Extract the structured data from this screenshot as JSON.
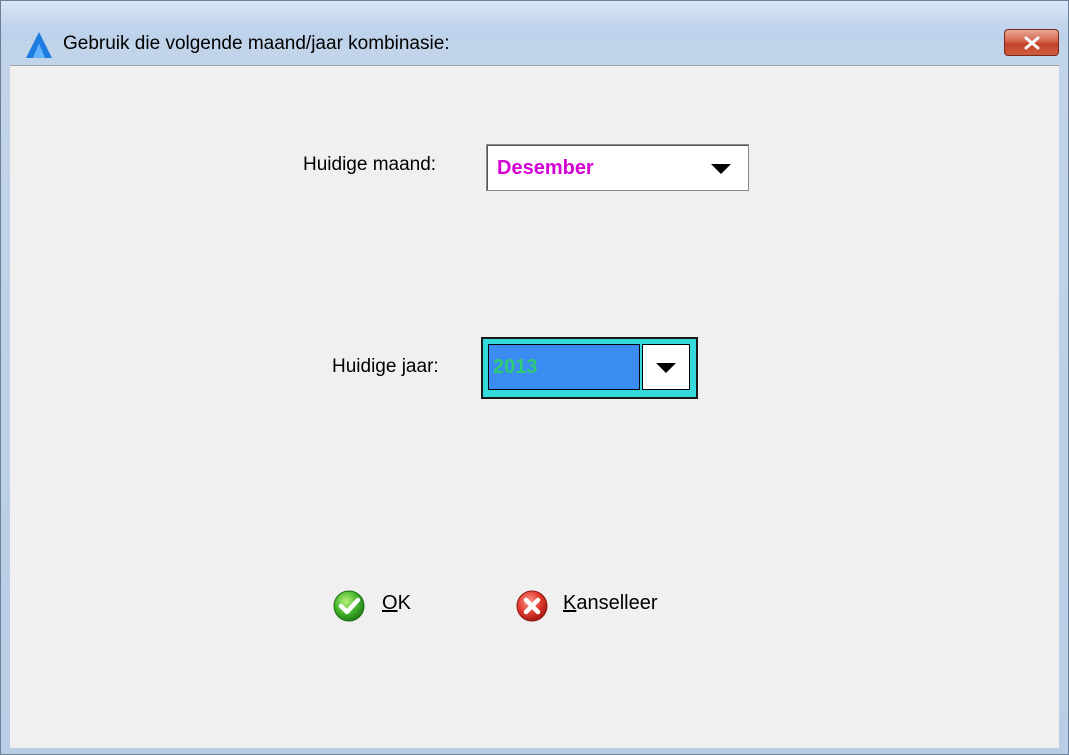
{
  "window": {
    "title": "Gebruik die volgende maand/jaar kombinasie:",
    "icons": {
      "app": "app-logo-icon",
      "close": "close-icon"
    }
  },
  "month": {
    "label": "Huidige maand:",
    "value": "Desember",
    "value_color": "#d400d4"
  },
  "year": {
    "label": "Huidige jaar:",
    "value": "2013",
    "value_color": "#2ecc71",
    "selection_color": "#3b8cf2",
    "focus_border_color": "#35d9d9"
  },
  "buttons": {
    "ok": {
      "mnemonic": "O",
      "rest": "K",
      "icon": "check-circle-icon"
    },
    "cancel": {
      "mnemonic": "K",
      "rest": "anselleer",
      "icon": "x-circle-icon"
    }
  }
}
